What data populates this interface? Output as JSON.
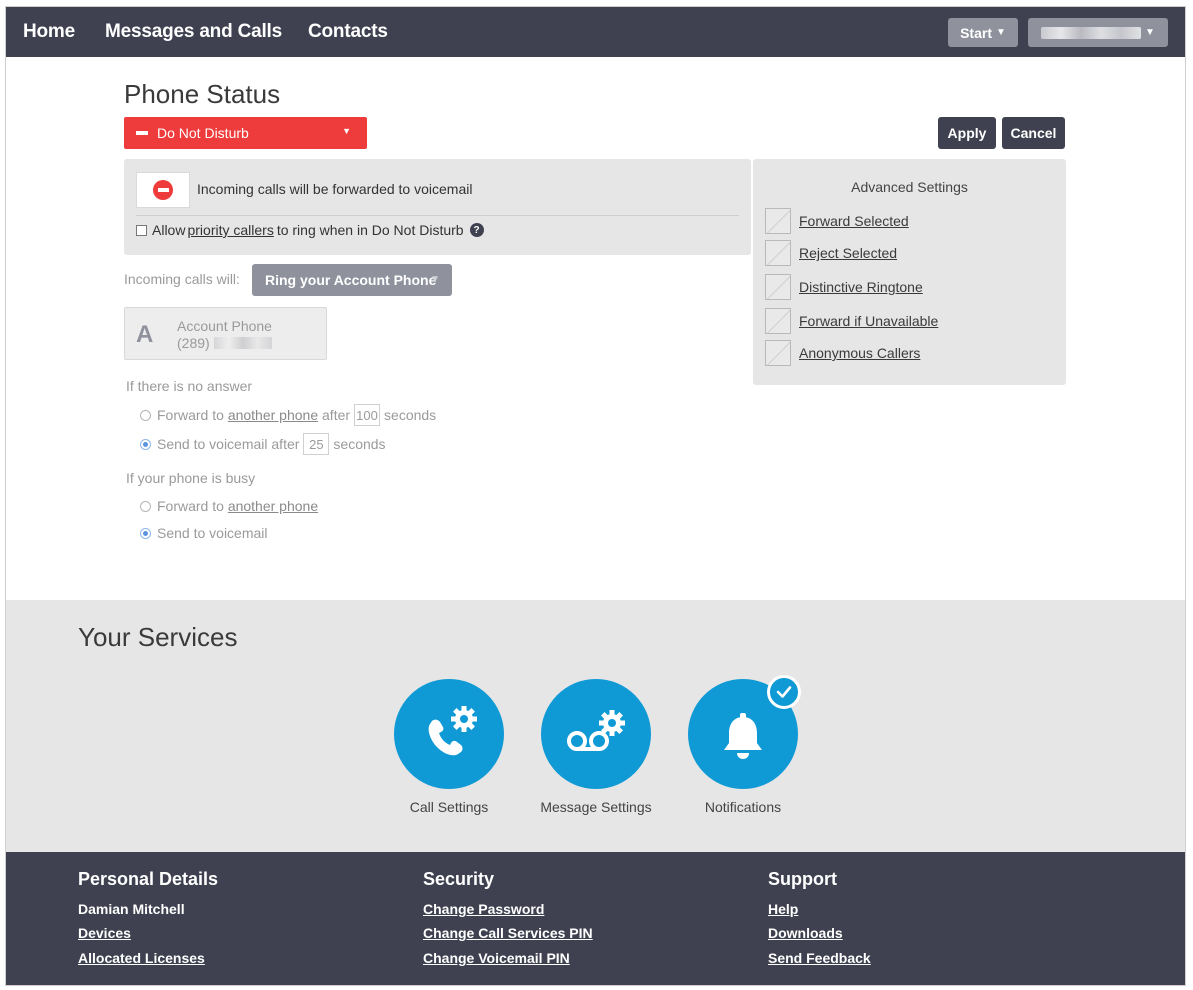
{
  "nav": {
    "links": [
      "Home",
      "Messages and Calls",
      "Contacts"
    ],
    "start_label": "Start",
    "user_label": ""
  },
  "phone_status": {
    "title": "Phone Status",
    "status": "Do Not Disturb",
    "apply": "Apply",
    "cancel": "Cancel",
    "forward_message": "Incoming calls will be forwarded to voicemail",
    "allow_prefix": "Allow",
    "allow_link": "priority callers",
    "allow_suffix": "to ring when in Do Not Disturb",
    "help_glyph": "?",
    "incoming_label": "Incoming calls will:",
    "ring_option": "Ring your Account Phone",
    "account": {
      "letter": "A",
      "name": "Account Phone",
      "number_prefix": "(289)"
    },
    "no_answer": {
      "label": "If there is no answer",
      "forward_prefix": "Forward to",
      "forward_link": "another phone",
      "forward_after": "after",
      "forward_seconds": "100",
      "seconds_label": "seconds",
      "voicemail_prefix": "Send to voicemail after",
      "voicemail_seconds": "25"
    },
    "busy": {
      "label": "If your phone is busy",
      "forward_prefix": "Forward to",
      "forward_link": "another phone",
      "voicemail": "Send to voicemail"
    }
  },
  "advanced": {
    "title": "Advanced Settings",
    "items": [
      "Forward Selected",
      "Reject Selected",
      "Distinctive Ringtone",
      "Forward if Unavailable",
      "Anonymous Callers"
    ]
  },
  "services": {
    "title": "Your Services",
    "items": [
      {
        "label": "Call Settings",
        "icon": "phone-gear-icon"
      },
      {
        "label": "Message Settings",
        "icon": "voicemail-gear-icon"
      },
      {
        "label": "Notifications",
        "icon": "bell-icon"
      }
    ]
  },
  "footer": {
    "personal": {
      "title": "Personal Details",
      "name": "Damian Mitchell",
      "devices": "Devices",
      "licenses": "Allocated Licenses"
    },
    "security": {
      "title": "Security",
      "change_password": "Change Password",
      "change_pin": "Change Call Services PIN",
      "change_voicemail_pin": "Change Voicemail PIN"
    },
    "support": {
      "title": "Support",
      "help": "Help",
      "downloads": "Downloads",
      "feedback": "Send Feedback"
    }
  },
  "colors": {
    "nav_bg": "#3f4150",
    "dnd_red": "#ee3b3b",
    "service_blue": "#0f9ad6",
    "panel_grey": "#e6e6e6"
  }
}
